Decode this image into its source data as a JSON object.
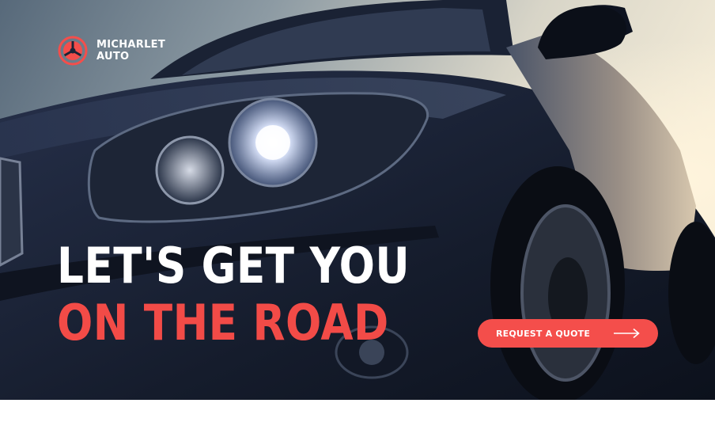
{
  "brand": {
    "name_line1": "MICHARLET",
    "name_line2": "AUTO",
    "icon": "tri-circle-logo-icon"
  },
  "hero": {
    "headline_line1": "LET'S GET YOU",
    "headline_line2": "ON THE ROAD",
    "image": "car-headlight-photo"
  },
  "cta": {
    "label": "REQUEST A QUOTE",
    "icon": "arrow-right-icon"
  },
  "colors": {
    "accent": "#f44e4b",
    "headline_red": "#f24b47",
    "text_light": "#ffffff",
    "car_body": "#1c2436"
  }
}
